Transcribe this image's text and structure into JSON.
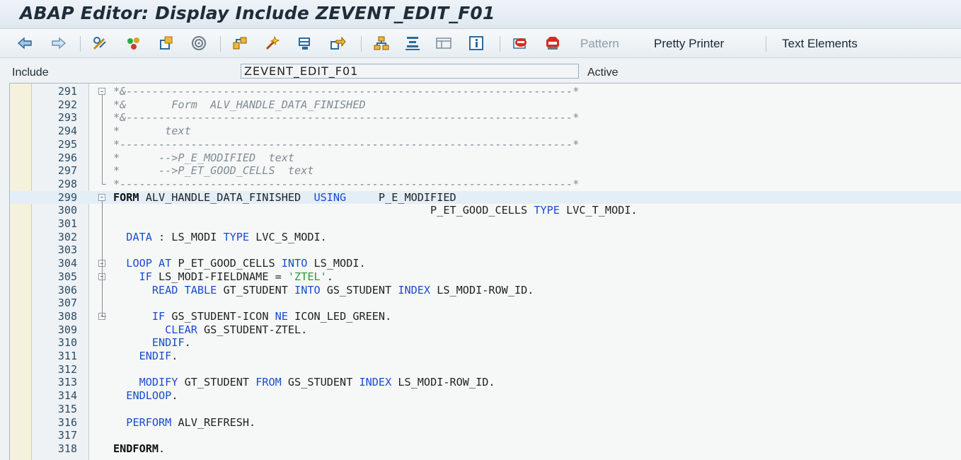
{
  "window": {
    "title": "ABAP Editor: Display Include ZEVENT_EDIT_F01"
  },
  "toolbar": {
    "icons": [
      "back-icon",
      "forward-icon",
      "display-change-icon",
      "check-icon",
      "activate-icon",
      "test-icon",
      "where-used-icon",
      "navigation-icon",
      "enhance-icon",
      "object-list-icon",
      "navigation-window-icon",
      "indent-icon",
      "screen-icon",
      "info-icon",
      "breakpoint-icon",
      "stop-icon"
    ],
    "pattern_label": "Pattern",
    "pretty_printer_label": "Pretty Printer",
    "text_elements_label": "Text Elements"
  },
  "header": {
    "include_label": "Include",
    "include_value": "ZEVENT_EDIT_F01",
    "status": "Active"
  },
  "editor": {
    "lines": [
      {
        "n": "291",
        "code": [
          {
            "t": "*&---------------------------------------------------------------------*",
            "c": "cmt"
          }
        ]
      },
      {
        "n": "292",
        "code": [
          {
            "t": "*&       Form  ALV_HANDLE_DATA_FINISHED",
            "c": "cmt"
          }
        ]
      },
      {
        "n": "293",
        "code": [
          {
            "t": "*&---------------------------------------------------------------------*",
            "c": "cmt"
          }
        ]
      },
      {
        "n": "294",
        "code": [
          {
            "t": "*       text",
            "c": "cmt"
          }
        ]
      },
      {
        "n": "295",
        "code": [
          {
            "t": "*----------------------------------------------------------------------*",
            "c": "cmt"
          }
        ]
      },
      {
        "n": "296",
        "code": [
          {
            "t": "*      -->P_E_MODIFIED  text",
            "c": "cmt"
          }
        ]
      },
      {
        "n": "297",
        "code": [
          {
            "t": "*      -->P_ET_GOOD_CELLS  text",
            "c": "cmt"
          }
        ]
      },
      {
        "n": "298",
        "code": [
          {
            "t": "*----------------------------------------------------------------------*",
            "c": "cmt"
          }
        ]
      },
      {
        "n": "299",
        "code": [
          {
            "t": "FORM ",
            "c": "kwb"
          },
          {
            "t": "ALV_HANDLE_DATA_FINISHED  ",
            "c": "id"
          },
          {
            "t": "USING",
            "c": "kw"
          },
          {
            "t": "     P_E_MODIFIED",
            "c": "id"
          }
        ]
      },
      {
        "n": "300",
        "code": [
          {
            "t": "                                                 P_ET_GOOD_CELLS ",
            "c": "id"
          },
          {
            "t": "TYPE",
            "c": "kw"
          },
          {
            "t": " LVC_T_MODI.",
            "c": "id"
          }
        ]
      },
      {
        "n": "301",
        "code": []
      },
      {
        "n": "302",
        "code": [
          {
            "t": "  ",
            "c": "id"
          },
          {
            "t": "DATA",
            "c": "kw"
          },
          {
            "t": " : LS_MODI ",
            "c": "id"
          },
          {
            "t": "TYPE",
            "c": "kw"
          },
          {
            "t": " LVC_S_MODI.",
            "c": "id"
          }
        ]
      },
      {
        "n": "303",
        "code": []
      },
      {
        "n": "304",
        "code": [
          {
            "t": "  ",
            "c": "id"
          },
          {
            "t": "LOOP AT",
            "c": "kw"
          },
          {
            "t": " P_ET_GOOD_CELLS ",
            "c": "id"
          },
          {
            "t": "INTO",
            "c": "kw"
          },
          {
            "t": " LS_MODI.",
            "c": "id"
          }
        ]
      },
      {
        "n": "305",
        "code": [
          {
            "t": "    ",
            "c": "id"
          },
          {
            "t": "IF",
            "c": "kw"
          },
          {
            "t": " LS_MODI-FIELDNAME = ",
            "c": "id"
          },
          {
            "t": "'ZTEL'",
            "c": "str"
          },
          {
            "t": ".",
            "c": "id"
          }
        ]
      },
      {
        "n": "306",
        "code": [
          {
            "t": "      ",
            "c": "id"
          },
          {
            "t": "READ TABLE",
            "c": "kw"
          },
          {
            "t": " GT_STUDENT ",
            "c": "id"
          },
          {
            "t": "INTO",
            "c": "kw"
          },
          {
            "t": " GS_STUDENT ",
            "c": "id"
          },
          {
            "t": "INDEX",
            "c": "kw"
          },
          {
            "t": " LS_MODI-ROW_ID.",
            "c": "id"
          }
        ]
      },
      {
        "n": "307",
        "code": []
      },
      {
        "n": "308",
        "code": [
          {
            "t": "      ",
            "c": "id"
          },
          {
            "t": "IF",
            "c": "kw"
          },
          {
            "t": " GS_STUDENT-ICON ",
            "c": "id"
          },
          {
            "t": "NE",
            "c": "kw"
          },
          {
            "t": " ICON_LED_GREEN.",
            "c": "id"
          }
        ]
      },
      {
        "n": "309",
        "code": [
          {
            "t": "        ",
            "c": "id"
          },
          {
            "t": "CLEAR",
            "c": "kw"
          },
          {
            "t": " GS_STUDENT-ZTEL.",
            "c": "id"
          }
        ]
      },
      {
        "n": "310",
        "code": [
          {
            "t": "      ",
            "c": "id"
          },
          {
            "t": "ENDIF",
            "c": "kw"
          },
          {
            "t": ".",
            "c": "id"
          }
        ]
      },
      {
        "n": "311",
        "code": [
          {
            "t": "    ",
            "c": "id"
          },
          {
            "t": "ENDIF",
            "c": "kw"
          },
          {
            "t": ".",
            "c": "id"
          }
        ]
      },
      {
        "n": "312",
        "code": []
      },
      {
        "n": "313",
        "code": [
          {
            "t": "    ",
            "c": "id"
          },
          {
            "t": "MODIFY",
            "c": "kw"
          },
          {
            "t": " GT_STUDENT ",
            "c": "id"
          },
          {
            "t": "FROM",
            "c": "kw"
          },
          {
            "t": " GS_STUDENT ",
            "c": "id"
          },
          {
            "t": "INDEX",
            "c": "kw"
          },
          {
            "t": " LS_MODI-ROW_ID.",
            "c": "id"
          }
        ]
      },
      {
        "n": "314",
        "code": [
          {
            "t": "  ",
            "c": "id"
          },
          {
            "t": "ENDLOOP",
            "c": "kw"
          },
          {
            "t": ".",
            "c": "id"
          }
        ]
      },
      {
        "n": "315",
        "code": []
      },
      {
        "n": "316",
        "code": [
          {
            "t": "  ",
            "c": "id"
          },
          {
            "t": "PERFORM",
            "c": "kw"
          },
          {
            "t": " ALV_REFRESH.",
            "c": "id"
          }
        ]
      },
      {
        "n": "317",
        "code": []
      },
      {
        "n": "318",
        "code": [
          {
            "t": "ENDFORM",
            "c": "kwb"
          },
          {
            "t": ".",
            "c": "id"
          }
        ]
      }
    ]
  }
}
